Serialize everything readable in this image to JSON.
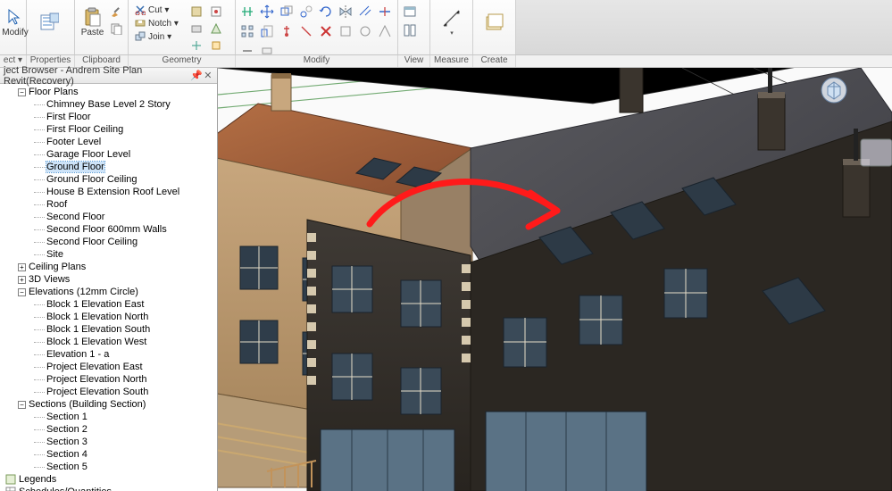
{
  "ribbon": {
    "groups": {
      "select": {
        "label": "ect ▾",
        "modify": "Modify"
      },
      "properties": {
        "label": "Properties",
        "btn": "Properties"
      },
      "clipboard": {
        "label": "Clipboard",
        "paste": "Paste",
        "cut": "Cut ▾",
        "notch": "Notch ▾",
        "join": "Join ▾"
      },
      "geometry": {
        "label": "Geometry"
      },
      "modify": {
        "label": "Modify"
      },
      "view": {
        "label": "View"
      },
      "measure": {
        "label": "Measure"
      },
      "create": {
        "label": "Create"
      }
    }
  },
  "browser": {
    "title": "ject Browser - Andrem Site Plan Revit(Recovery)",
    "tree": {
      "floor_plans": {
        "label": "Floor Plans",
        "items": [
          "Chimney Base Level 2 Story",
          "First Floor",
          "First Floor Ceiling",
          "Footer Level",
          "Garage Floor Level",
          "Ground Floor",
          "Ground Floor Ceiling",
          "House B Extension Roof Level",
          "Roof",
          "Second Floor",
          "Second Floor 600mm Walls",
          "Second Floor Ceiling",
          "Site"
        ],
        "selected_index": 5
      },
      "ceiling_plans": "Ceiling Plans",
      "three_d": "3D Views",
      "elevations": {
        "label": "Elevations (12mm Circle)",
        "items": [
          "Block 1 Elevation East",
          "Block 1 Elevation North",
          "Block 1 Elevation South",
          "Block 1 Elevation West",
          "Elevation 1 - a",
          "Project Elevation East",
          "Project Elevation North",
          "Project Elevation South"
        ]
      },
      "sections": {
        "label": "Sections (Building Section)",
        "items": [
          "Section 1",
          "Section 2",
          "Section 3",
          "Section 4",
          "Section 5"
        ]
      },
      "legends": "Legends",
      "schedules": "Schedules/Quantities"
    }
  }
}
